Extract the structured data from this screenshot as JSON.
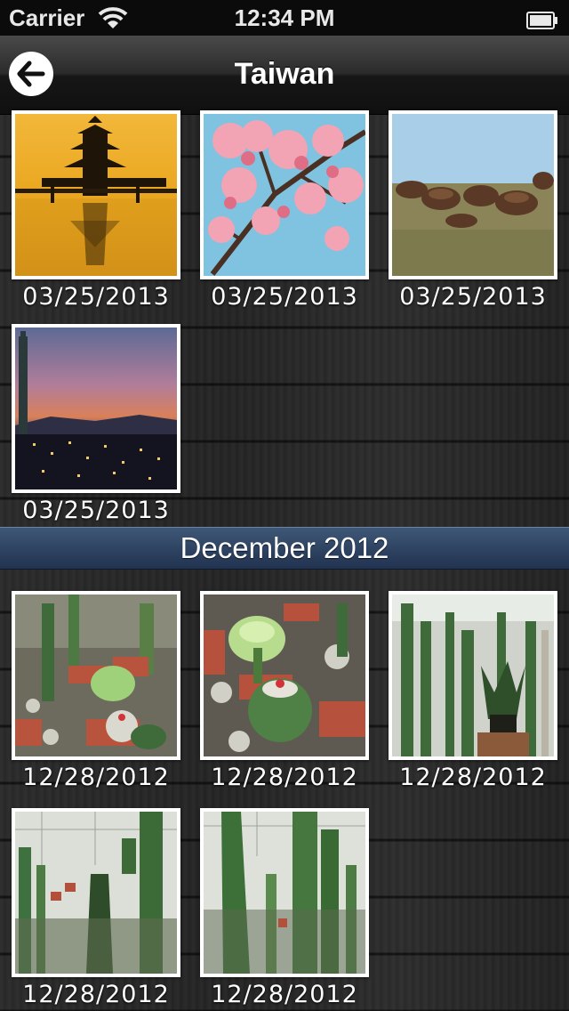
{
  "status_bar": {
    "carrier": "Carrier",
    "time": "12:34 PM"
  },
  "nav": {
    "title": "Taiwan",
    "back_icon": "arrow-left-icon"
  },
  "sections": [
    {
      "header": "",
      "photos": [
        {
          "date": "03/25/2013",
          "subject": "pagoda-sunset"
        },
        {
          "date": "03/25/2013",
          "subject": "cherry-blossom"
        },
        {
          "date": "03/25/2013",
          "subject": "rock-coast"
        },
        {
          "date": "03/25/2013",
          "subject": "city-skyline-dusk"
        }
      ]
    },
    {
      "header": "December 2012",
      "photos": [
        {
          "date": "12/28/2012",
          "subject": "cactus-pots"
        },
        {
          "date": "12/28/2012",
          "subject": "cactus-closeup"
        },
        {
          "date": "12/28/2012",
          "subject": "cactus-greenhouse"
        },
        {
          "date": "12/28/2012",
          "subject": "greenhouse-tall-cactus"
        },
        {
          "date": "12/28/2012",
          "subject": "greenhouse-column-cactus"
        }
      ]
    }
  ]
}
